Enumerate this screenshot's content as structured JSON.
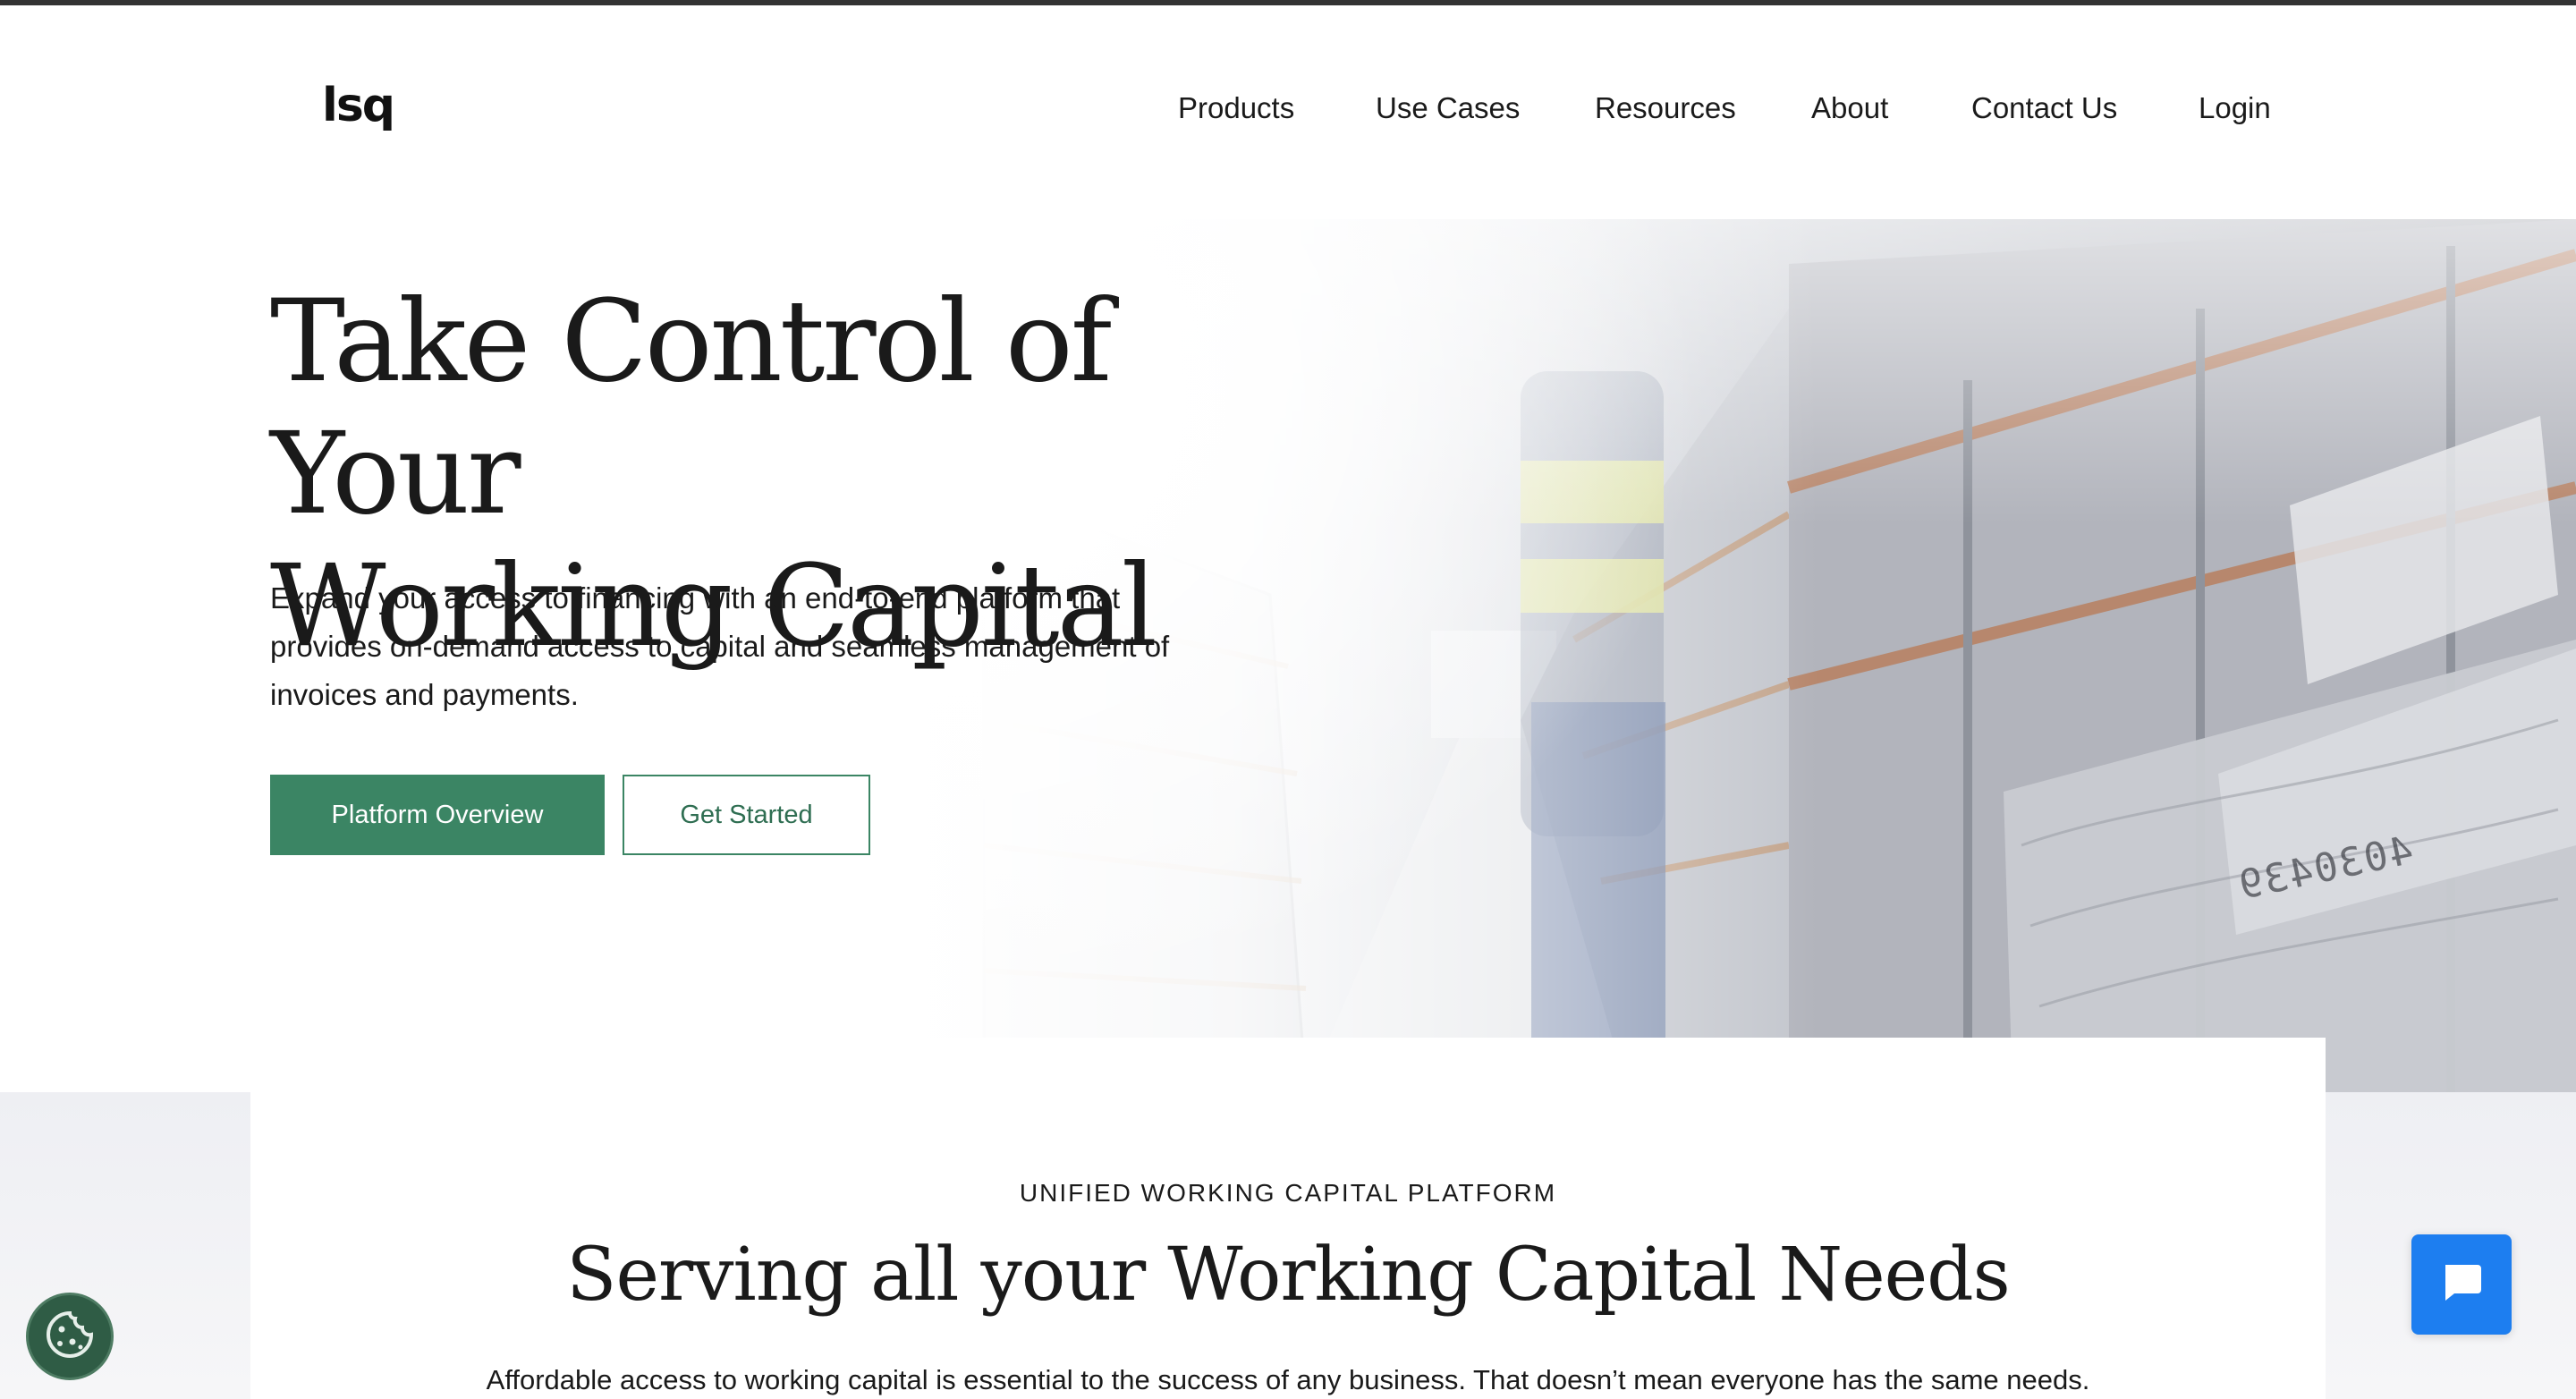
{
  "header": {
    "logo_text": "lsq",
    "nav": [
      "Products",
      "Use Cases",
      "Resources",
      "About",
      "Contact Us",
      "Login"
    ]
  },
  "hero": {
    "title_line1": "Take Control of Your",
    "title_line2": "Working Capital",
    "description": "Expand your access to financing with an end-to-end platform that provides on-demand access to capital and seamless management of invoices and payments.",
    "primary_button": "Platform Overview",
    "secondary_button": "Get Started",
    "image_text": "4030439"
  },
  "section": {
    "eyebrow": "UNIFIED WORKING CAPITAL PLATFORM",
    "title": "Serving all your Working Capital Needs",
    "text": "Affordable access to working capital is essential to the success of any business. That doesn’t mean everyone has the same needs."
  },
  "widgets": {
    "cookie_icon": "cookie-icon",
    "chat_icon": "chat-bubble-icon"
  },
  "colors": {
    "brand_green": "#3b8564",
    "chat_blue": "#1d7ef0",
    "cookie_green": "#2f5c45"
  }
}
